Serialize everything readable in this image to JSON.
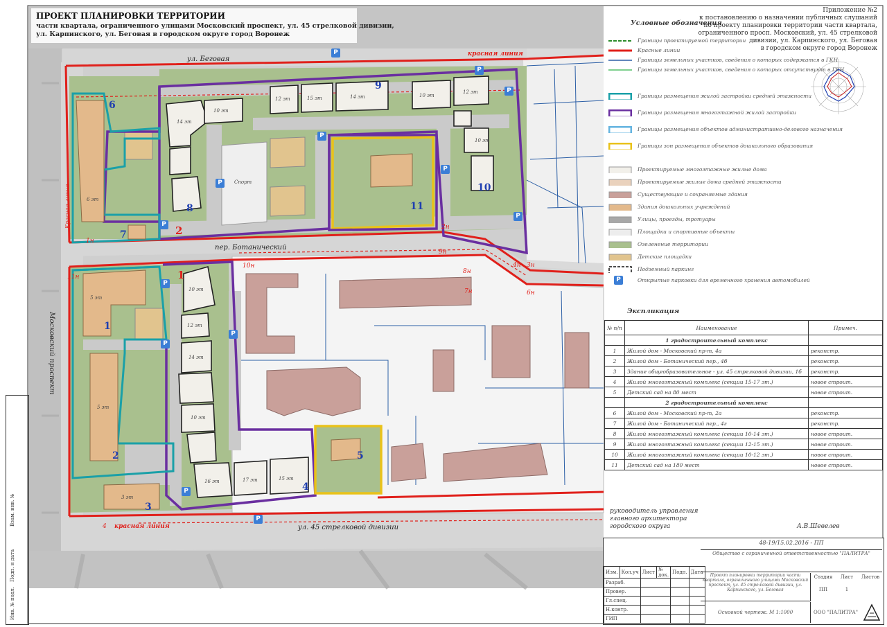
{
  "header": {
    "title": "ПРОЕКТ ПЛАНИРОВКИ ТЕРРИТОРИИ",
    "subtitle_1": "части квартала, ограниченного улицами Московский проспект, ул. 45 стрелковой дивизии,",
    "subtitle_2": "ул. Карпинского, ул. Беговая в городском округе город Воронеж"
  },
  "appendix": {
    "line_1": "Приложение №2",
    "line_2": "к постановлению о назначении публичных слушаний",
    "line_3": "по проекту планировки территории части квартала,",
    "line_4": "ограниченного просп. Московский, ул. 45 стрелковой",
    "line_5": "дивизии, ул. Карпинского, ул. Беговая",
    "line_6": "в городском округе город Воронеж"
  },
  "map": {
    "streets": {
      "begovaya": "ул. Беговая",
      "botanical": "пер. Ботанический",
      "moskovsky": "Московский проспект",
      "div45": "ул. 45 стрелковой дивизии",
      "red_line_1": "красная линия",
      "red_line_2": "красная линия",
      "karpinskogo": "Красная линия"
    },
    "zone_numbers": [
      "1",
      "2",
      "3",
      "4",
      "5",
      "6",
      "7",
      "8",
      "9",
      "10",
      "11"
    ],
    "plot_numbers": [
      "2",
      "1"
    ],
    "red_points": [
      "1н",
      "11н",
      "10н",
      "9н",
      "8н",
      "7н",
      "6н",
      "4н",
      "3н",
      "2н",
      "4"
    ],
    "building_labels": {
      "b6": "6 эт",
      "b8a": "10 эт",
      "b8b": "14 эт",
      "b9a": "12 эт",
      "b9b": "15 эт",
      "b9c": "14 эт",
      "b10a": "10 эт",
      "b10b": "12 эт",
      "b10c": "10 эт",
      "b1": "5 эт",
      "b2": "5 эт",
      "bc1": "10 эт",
      "bc2": "12 эт",
      "bc3": "14 эт",
      "bc4": "10 эт",
      "b4a": "16 эт",
      "b4b": "17 эт",
      "b4c": "15 эт",
      "b3": "3 эт",
      "sport": "Спорт"
    },
    "parking_letter": "P"
  },
  "legend": {
    "title": "Условные обозначения",
    "items": [
      "Границы проектируемой территории",
      "Красные линии",
      "Границы земельных участков, сведения о которых содержатся в ГКН",
      "Границы земельных участков, сведения о которых отсутствуют в ГКН",
      "Границы размещения жилой застройки средней этажности",
      "Границы размещения многоэтажной жилой застройки",
      "Границы размещения объектов административно-делового назначения",
      "Границы зон размещения объектов дошкольного образования",
      "Проектируемые многоэтажные жилые дома",
      "Проектируемые жилые дома средней этажности",
      "Существующие и сохраняемые здания",
      "Здания дошкольных учреждений",
      "Улицы, проезды, тротуары",
      "Площадки и спортивные объекты",
      "Озеленение территории",
      "Детские площадки",
      "Подземный паркинг",
      "Открытые парковки для временного хранения автомобилей"
    ],
    "parking_symbol": "P"
  },
  "explication": {
    "title": "Экспликация",
    "headers": [
      "№ п/п",
      "Наименование",
      "Примеч."
    ],
    "group_1": "1 градостроительный комплекс",
    "group_2": "2 градостроительный комплекс",
    "rows_1": [
      {
        "n": "1",
        "name": "Жилой дом - Московский пр-т, 4а",
        "note": "реконстр."
      },
      {
        "n": "2",
        "name": "Жилой дом - Ботанический пер., 4б",
        "note": "реконстр."
      },
      {
        "n": "3",
        "name": "Здание общеобразовательное - ул. 45 стрелковой дивизии, 1б",
        "note": "реконстр."
      },
      {
        "n": "4",
        "name": "Жилой многоэтажный комплекс (секции 15-17 эт.)",
        "note": "новое строит."
      },
      {
        "n": "5",
        "name": "Детский сад на 80 мест",
        "note": "новое строит."
      }
    ],
    "rows_2": [
      {
        "n": "6",
        "name": "Жилой дом - Московский пр-т, 2а",
        "note": "реконстр."
      },
      {
        "n": "7",
        "name": "Жилой дом - Ботанический пер., 4г",
        "note": "реконстр."
      },
      {
        "n": "8",
        "name": "Жилой многоэтажный комплекс (секции 10-14 эт.)",
        "note": "новое строит."
      },
      {
        "n": "9",
        "name": "Жилой многоэтажный комплекс (секции 12-15 эт.)",
        "note": "новое строит."
      },
      {
        "n": "10",
        "name": "Жилой многоэтажный комплекс (секции 10-12 эт.)",
        "note": "новое строит."
      },
      {
        "n": "11",
        "name": "Детский сад на 180 мест",
        "note": "новое строит."
      }
    ]
  },
  "signature": {
    "role_1": "руководитель управления",
    "role_2": "главного архитектора",
    "role_3": "городского округа",
    "name": "А.В.Шевелев"
  },
  "stamp": {
    "code": "48-19/15.02.2016 - ПП",
    "org": "Общество с ограниченной ответственностью \"ПАЛИТРА\"",
    "header_cells": [
      "Изм.",
      "Кол.уч",
      "Лист",
      "№ док.",
      "Подп.",
      "Дата"
    ],
    "roles": [
      "Разраб.",
      "Провер.",
      "Гл.спец.",
      "Н.контр.",
      "ГИП"
    ],
    "project": "Проект планировки территории части квартала, ограниченного улицами Московский проспект, ул. 45 стрелковой дивизии, ул. Карпинского, ул. Беговая",
    "sheet_name": "Основной чертеж. М 1:1000",
    "stage_headers": [
      "Стадия",
      "Лист",
      "Листов"
    ],
    "stage_values": [
      "ПП",
      "1",
      ""
    ],
    "company": "ООО \"ПАЛИТРА\""
  },
  "side_stamp": [
    "Взам. инв. №",
    "Подп. и дата",
    "Инв. № подл."
  ],
  "colors": {
    "red_line": "#e0201b",
    "purple": "#6a2fa0",
    "teal": "#1aa0a8",
    "yellow": "#e9c21a",
    "green": "#9bba82",
    "road": "#c9c9c9",
    "building_new": "#f2f0ea",
    "building_existing": "#c9a09a",
    "building_mid": "#e3b98b",
    "parking": "#3b7ed6"
  }
}
